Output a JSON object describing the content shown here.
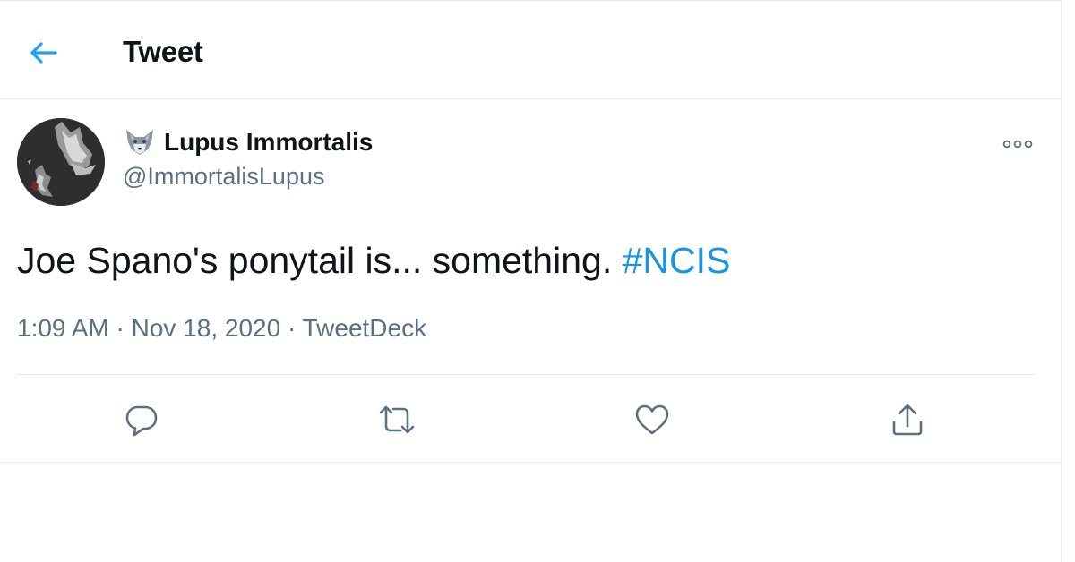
{
  "header": {
    "back_icon": "arrow-left-icon",
    "title": "Tweet"
  },
  "tweet": {
    "author": {
      "display_name": "Lupus Immortalis",
      "handle": "@ImmortalisLupus",
      "name_emoji": "wolf-emoji",
      "avatar": "wolf-avatar"
    },
    "more_icon": "more-icon",
    "text": "Joe Spano's ponytail is... something. ",
    "hashtag": "#NCIS",
    "time": "1:09 AM",
    "separator": "·",
    "date": "Nov 18, 2020",
    "source": "TweetDeck"
  },
  "actions": [
    {
      "icon": "reply-icon"
    },
    {
      "icon": "retweet-icon"
    },
    {
      "icon": "like-icon"
    },
    {
      "icon": "share-icon"
    }
  ],
  "colors": {
    "accent": "#1da1f2",
    "hashtag": "#1b95e0",
    "text": "#0f1419",
    "secondary": "#5b7083",
    "border": "#e6ecf0"
  }
}
